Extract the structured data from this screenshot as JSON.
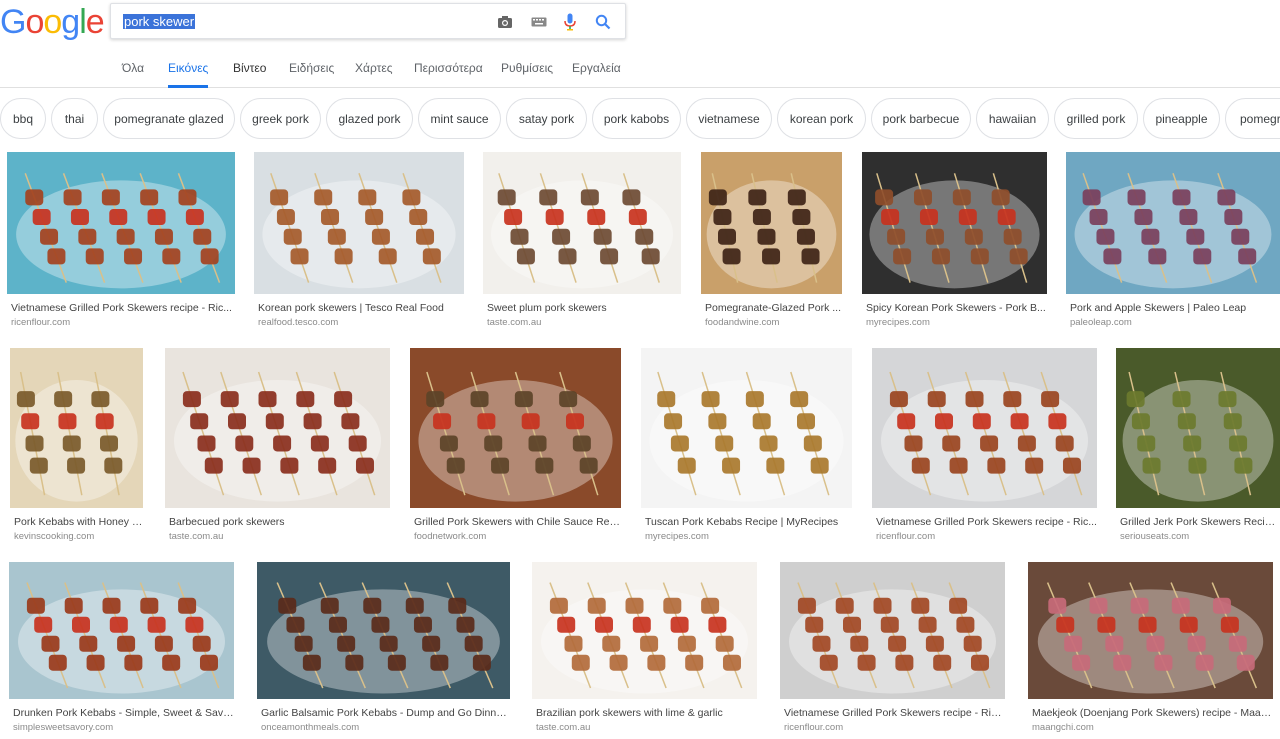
{
  "header": {
    "logo_letters": [
      "G",
      "o",
      "o",
      "g",
      "l",
      "e"
    ],
    "logo_colors": [
      "#4285f4",
      "#ea4335",
      "#fbbc05",
      "#4285f4",
      "#34a853",
      "#ea4335"
    ],
    "query": "pork skewer"
  },
  "nav": [
    "Όλα",
    "Εικόνες",
    "Βίντεο",
    "Ειδήσεις",
    "Χάρτες",
    "Περισσότερα",
    "Ρυθμίσεις",
    "Εργαλεία"
  ],
  "chips": [
    "bbq",
    "thai",
    "pomegranate glazed",
    "greek pork",
    "glazed pork",
    "mint sauce",
    "satay pork",
    "pork kabobs",
    "vietnamese",
    "korean pork",
    "pork barbecue",
    "hawaiian",
    "grilled pork",
    "pineapple",
    "pomegranate"
  ],
  "results": [
    {
      "title": "Vietnamese Grilled Pork Skewers recipe - Ric...",
      "source": "ricenflour.com",
      "bg": "#5db3c9",
      "fg": "#a4421e"
    },
    {
      "title": "Korean pork skewers | Tesco Real Food",
      "source": "realfood.tesco.com",
      "bg": "#d9dfe3",
      "fg": "#a55a2a"
    },
    {
      "title": "Sweet plum pork skewers",
      "source": "taste.com.au",
      "bg": "#f2f0ec",
      "fg": "#6d4a33"
    },
    {
      "title": "Pomegranate-Glazed Pork ...",
      "source": "foodandwine.com",
      "bg": "#c9a06a",
      "fg": "#3e2417"
    },
    {
      "title": "Spicy Korean Pork Skewers - Pork B...",
      "source": "myrecipes.com",
      "bg": "#2f2f2f",
      "fg": "#8f4e2b"
    },
    {
      "title": "Pork and Apple Skewers | Paleo Leap",
      "source": "paleoleap.com",
      "bg": "#6fa7c2",
      "fg": "#7a3f5c"
    },
    {
      "title": "Pork Kebabs with Honey M...",
      "source": "kevinscooking.com",
      "bg": "#e4d6b8",
      "fg": "#7a5a2a"
    },
    {
      "title": "Barbecued pork skewers",
      "source": "taste.com.au",
      "bg": "#e9e4de",
      "fg": "#8a2e1c"
    },
    {
      "title": "Grilled Pork Skewers with Chile Sauce Rec...",
      "source": "foodnetwork.com",
      "bg": "#8a4a2a",
      "fg": "#5c4328"
    },
    {
      "title": "Tuscan Pork Kebabs Recipe | MyRecipes",
      "source": "myrecipes.com",
      "bg": "#f4f4f4",
      "fg": "#a9782c"
    },
    {
      "title": "Vietnamese Grilled Pork Skewers recipe - Ric...",
      "source": "ricenflour.com",
      "bg": "#d5d6d8",
      "fg": "#9a4420"
    },
    {
      "title": "Grilled Jerk Pork Skewers Recipe | Serio...",
      "source": "seriouseats.com",
      "bg": "#4a5a2a",
      "fg": "#6b7a2e"
    },
    {
      "title": "Drunken Pork Kebabs - Simple, Sweet & Savory",
      "source": "simplesweetsavory.com",
      "bg": "#a9c5cf",
      "fg": "#9a3a1a"
    },
    {
      "title": "Garlic Balsamic Pork Kebabs - Dump and Go Dinner ...",
      "source": "onceamonthmeals.com",
      "bg": "#3e5a66",
      "fg": "#5a2a1a"
    },
    {
      "title": "Brazilian pork skewers with lime & garlic",
      "source": "taste.com.au",
      "bg": "#f5f2ee",
      "fg": "#b26a3a"
    },
    {
      "title": "Vietnamese Grilled Pork Skewers recipe - Rice...",
      "source": "ricenflour.com",
      "bg": "#cfcfcf",
      "fg": "#a24824"
    },
    {
      "title": "Maekjeok (Doenjang Pork Skewers) recipe - Maan...",
      "source": "maangchi.com",
      "bg": "#6a4a3a",
      "fg": "#c86a7a"
    }
  ]
}
